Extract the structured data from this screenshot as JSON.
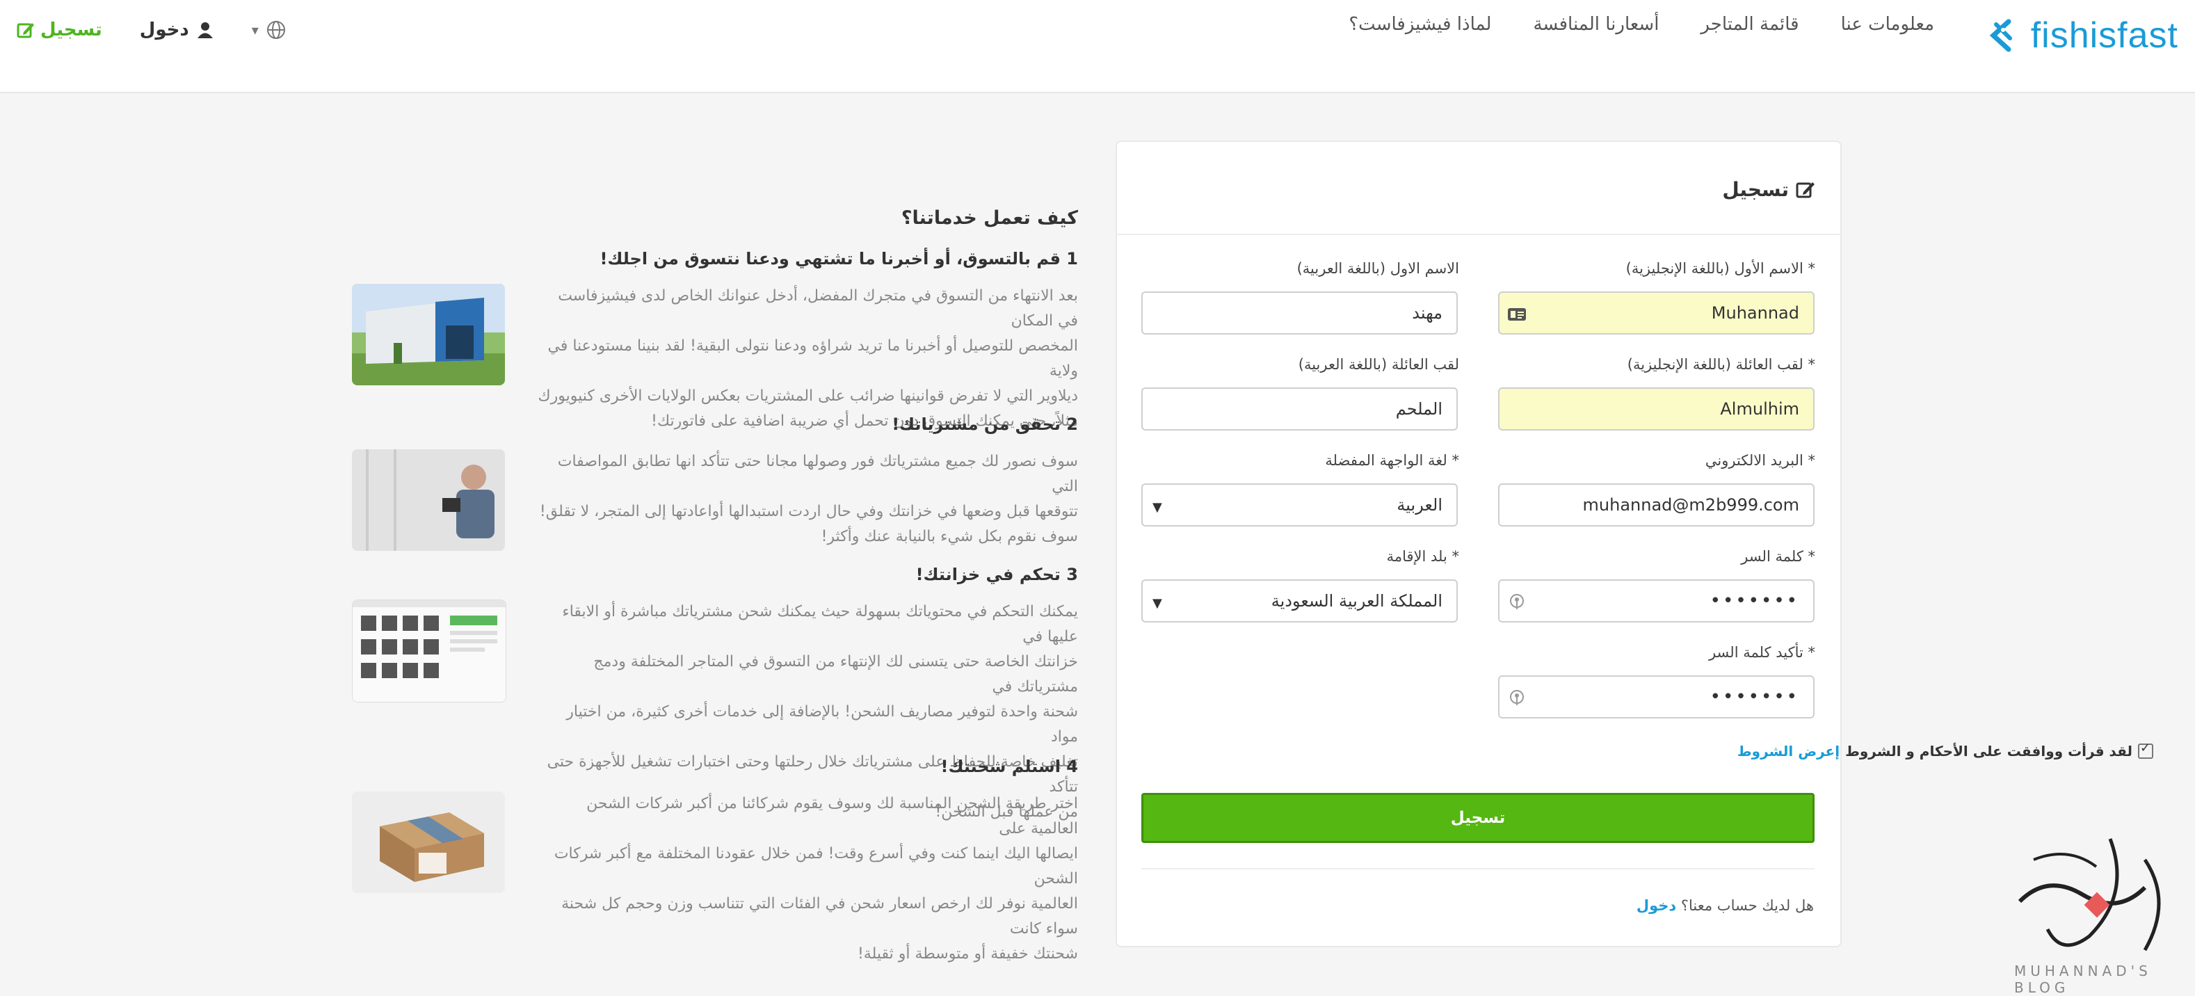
{
  "header": {
    "brand": "fishisfast",
    "nav": [
      "لماذا فيشيزفاست؟",
      "أسعارنا المنافسة",
      "قائمة المتاجر",
      "معلومات عنا"
    ],
    "login_label": "دخول",
    "signup_label": "تسجيل"
  },
  "form": {
    "title": "تسجيل",
    "first_name_en_label": "* الاسم الأول (باللغة الإنجليزية)",
    "first_name_en_value": "Muhannad",
    "first_name_ar_label": "الاسم الاول (باللغة العربية)",
    "first_name_ar_value": "مهند",
    "last_name_en_label": "* لقب العائلة (باللغة الإنجليزية)",
    "last_name_en_value": "Almulhim",
    "last_name_ar_label": "لقب العائلة (باللغة العربية)",
    "last_name_ar_value": "الملحم",
    "email_label": "* البريد الالكتروني",
    "email_value": "muhannad@m2b999.com",
    "ui_lang_label": "* لغة الواجهة المفضلة",
    "ui_lang_value": "العربية",
    "password_label": "* كلمة السر",
    "password_value": "•••••••",
    "country_label": "* بلد الإقامة",
    "country_value": "المملكة العربية السعودية",
    "confirm_label": "* تأكيد كلمة السر",
    "confirm_value": "•••••••",
    "terms_text": "لقد قرأت ووافقت على الأحكام و الشروط",
    "terms_link": "إعرض الشروط",
    "submit_label": "تسجيل",
    "have_account": "هل لديك حساب معنا؟",
    "login_link": "دخول"
  },
  "info": {
    "title": "كيف تعمل خدماتنا؟",
    "steps": [
      {
        "heading": "1 قم بالتسوق، أو أخبرنا ما تشتهي ودعنا نتسوق من اجلك!",
        "lines": [
          "بعد الانتهاء من التسوق في متجرك المفضل، أدخل عنوانك الخاص لدى فيشيزفاست في المكان",
          "المخصص للتوصيل أو أخبرنا ما تريد شراؤه ودعنا نتولى البقية! لقد بنينا مستودعنا في ولاية",
          "ديلاوير التي لا تفرض قوانينها ضرائب على المشتريات بعكس الولايات الأخرى كنيويورك",
          "مثلاً، حتى يمكنك التسوق دون تحمل أي ضريبة اضافية على فاتورتك!"
        ]
      },
      {
        "heading": "2 تحقق من مشترياتك!",
        "lines": [
          "سوف نصور لك جميع مشترياتك فور وصولها مجانا حتى تتأكد انها تطابق المواصفات التي",
          "تتوقعها قبل وضعها في خزانتك وفي حال اردت استبدالها أواعادتها إلى المتجر، لا تقلق!",
          "سوف نقوم بكل شيء بالنيابة عنك وأكثر!"
        ]
      },
      {
        "heading": "3 تحكم في خزانتك!",
        "lines": [
          "يمكنك التحكم في محتوياتك بسهولة حيث يمكنك شحن مشترياتك مباشرة أو الابقاء عليها في",
          "خزانتك الخاصة حتى يتسنى لك الإنتهاء من التسوق في المتاجر المختلفة ودمج مشترياتك في",
          "شحنة واحدة لتوفير مصاريف الشحن! بالإضافة إلى خدمات أخرى كثيرة، من اختيار مواد",
          "تغليف خاصة للحفاظ على مشترياتك خلال رحلتها وحتى اختبارات تشغيل للأجهزة حتى تتأكد",
          "من عملها قبل الشحن!"
        ]
      },
      {
        "heading": "4 استلم شحنتك!",
        "lines": [
          "اختر طريقة الشحن المناسبة لك وسوف يقوم شركائنا من أكبر شركات الشحن العالمية على",
          "ايصالها اليك اينما كنت وفي أسرع وقت! فمن خلال عقودنا المختلفة مع أكبر شركات الشحن",
          "العالمية نوفر لك ارخص اسعار شحن في الفئات التي تتناسب وزن وحجم كل شحنة سواء كانت",
          "شحنتك خفيفة أو متوسطة أو ثقيلة!"
        ]
      }
    ]
  },
  "watermark": {
    "text": "MUHANNAD'S BLOG"
  },
  "colors": {
    "brand_blue": "#1a9bd7",
    "green": "#55b711",
    "autofill_yellow": "#fbfbc8"
  }
}
